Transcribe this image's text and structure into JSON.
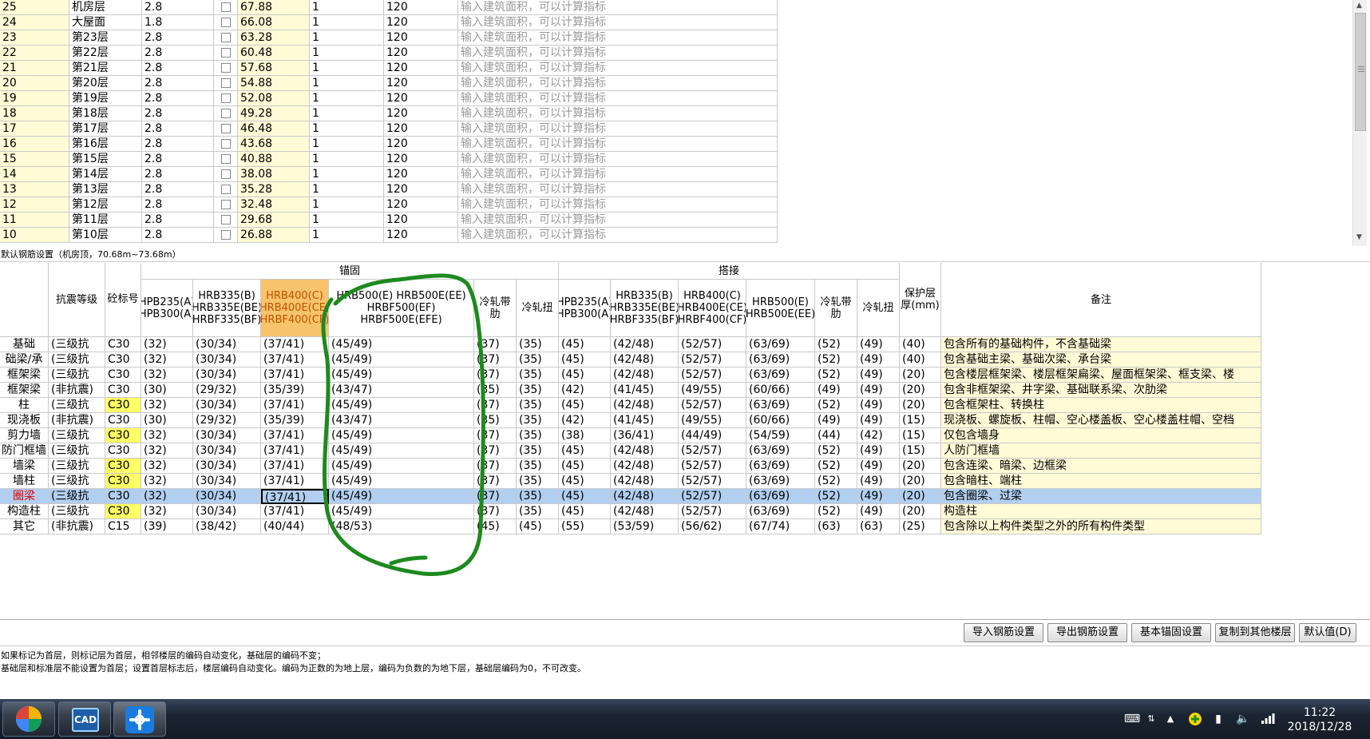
{
  "floors": [
    {
      "code": "25",
      "name": "机房层",
      "height": "2.8",
      "elevation": "67.88",
      "count": "1",
      "thickness": "120",
      "area_hint": "输入建筑面积，可以计算指标"
    },
    {
      "code": "24",
      "name": "大屋面",
      "height": "1.8",
      "elevation": "66.08",
      "count": "1",
      "thickness": "120",
      "area_hint": "输入建筑面积，可以计算指标"
    },
    {
      "code": "23",
      "name": "第23层",
      "height": "2.8",
      "elevation": "63.28",
      "count": "1",
      "thickness": "120",
      "area_hint": "输入建筑面积，可以计算指标"
    },
    {
      "code": "22",
      "name": "第22层",
      "height": "2.8",
      "elevation": "60.48",
      "count": "1",
      "thickness": "120",
      "area_hint": "输入建筑面积，可以计算指标"
    },
    {
      "code": "21",
      "name": "第21层",
      "height": "2.8",
      "elevation": "57.68",
      "count": "1",
      "thickness": "120",
      "area_hint": "输入建筑面积，可以计算指标"
    },
    {
      "code": "20",
      "name": "第20层",
      "height": "2.8",
      "elevation": "54.88",
      "count": "1",
      "thickness": "120",
      "area_hint": "输入建筑面积，可以计算指标"
    },
    {
      "code": "19",
      "name": "第19层",
      "height": "2.8",
      "elevation": "52.08",
      "count": "1",
      "thickness": "120",
      "area_hint": "输入建筑面积，可以计算指标"
    },
    {
      "code": "18",
      "name": "第18层",
      "height": "2.8",
      "elevation": "49.28",
      "count": "1",
      "thickness": "120",
      "area_hint": "输入建筑面积，可以计算指标"
    },
    {
      "code": "17",
      "name": "第17层",
      "height": "2.8",
      "elevation": "46.48",
      "count": "1",
      "thickness": "120",
      "area_hint": "输入建筑面积，可以计算指标"
    },
    {
      "code": "16",
      "name": "第16层",
      "height": "2.8",
      "elevation": "43.68",
      "count": "1",
      "thickness": "120",
      "area_hint": "输入建筑面积，可以计算指标"
    },
    {
      "code": "15",
      "name": "第15层",
      "height": "2.8",
      "elevation": "40.88",
      "count": "1",
      "thickness": "120",
      "area_hint": "输入建筑面积，可以计算指标"
    },
    {
      "code": "14",
      "name": "第14层",
      "height": "2.8",
      "elevation": "38.08",
      "count": "1",
      "thickness": "120",
      "area_hint": "输入建筑面积，可以计算指标"
    },
    {
      "code": "13",
      "name": "第13层",
      "height": "2.8",
      "elevation": "35.28",
      "count": "1",
      "thickness": "120",
      "area_hint": "输入建筑面积，可以计算指标"
    },
    {
      "code": "12",
      "name": "第12层",
      "height": "2.8",
      "elevation": "32.48",
      "count": "1",
      "thickness": "120",
      "area_hint": "输入建筑面积，可以计算指标"
    },
    {
      "code": "11",
      "name": "第11层",
      "height": "2.8",
      "elevation": "29.68",
      "count": "1",
      "thickness": "120",
      "area_hint": "输入建筑面积，可以计算指标"
    },
    {
      "code": "10",
      "name": "第10层",
      "height": "2.8",
      "elevation": "26.88",
      "count": "1",
      "thickness": "120",
      "area_hint": "输入建筑面积，可以计算指标"
    }
  ],
  "section_title": "默认钢筋设置（机房顶，70.68m~73.68m）",
  "headers": {
    "seismic": "抗震等级",
    "concrete": "砼标号",
    "anchor_group": "锚固",
    "lap_group": "搭接",
    "a_hpb": "HPB235(A) HPB300(A)",
    "a_hrb335": "HRB335(B) HRB335E(BE) HRBF335(BF)",
    "a_hrb400": "HRB400(C) HRB400E(CE) HRBF400(CF)",
    "a_hrb500": "HRB500(E) HRB500E(EE) HRBF500(EF) HRBF500E(EFE)",
    "a_cold_ribbed": "冷轧带肋",
    "a_cold_twisted": "冷轧扭",
    "l_hpb": "HPB235(A) HPB300(A)",
    "l_hrb335": "HRB335(B) HRB335E(BE) HRBF335(BF)",
    "l_hrb400": "HRB400(C) HRB400E(CE) HRBF400(CF)",
    "l_hrb500": "HRB500(E) HRB500E(EE)",
    "l_cold_ribbed": "冷轧带肋",
    "l_cold_twisted": "冷轧扭",
    "cover": "保护层厚(mm)",
    "note": "备注"
  },
  "rows": [
    {
      "type": "基础",
      "seismic": "(三级抗",
      "concrete": "C30",
      "a1": "(32)",
      "a2": "(30/34)",
      "a3": "(37/41)",
      "a4": "(45/49)",
      "a5": "(37)",
      "a6": "(35)",
      "l1": "(45)",
      "l2": "(42/48)",
      "l3": "(52/57)",
      "l4": "(63/69)",
      "l5": "(52)",
      "l6": "(49)",
      "cover": "(40)",
      "note": "包含所有的基础构件，不含基础梁"
    },
    {
      "type": "础梁/承",
      "seismic": "(三级抗",
      "concrete": "C30",
      "a1": "(32)",
      "a2": "(30/34)",
      "a3": "(37/41)",
      "a4": "(45/49)",
      "a5": "(37)",
      "a6": "(35)",
      "l1": "(45)",
      "l2": "(42/48)",
      "l3": "(52/57)",
      "l4": "(63/69)",
      "l5": "(52)",
      "l6": "(49)",
      "cover": "(40)",
      "note": "包含基础主梁、基础次梁、承台梁"
    },
    {
      "type": "框架梁",
      "seismic": "(三级抗",
      "concrete": "C30",
      "a1": "(32)",
      "a2": "(30/34)",
      "a3": "(37/41)",
      "a4": "(45/49)",
      "a5": "(37)",
      "a6": "(35)",
      "l1": "(45)",
      "l2": "(42/48)",
      "l3": "(52/57)",
      "l4": "(63/69)",
      "l5": "(52)",
      "l6": "(49)",
      "cover": "(20)",
      "note": "包含楼层框架梁、楼层框架扁梁、屋面框架梁、框支梁、楼"
    },
    {
      "type": "框架梁",
      "seismic": "(非抗震)",
      "concrete": "C30",
      "a1": "(30)",
      "a2": "(29/32)",
      "a3": "(35/39)",
      "a4": "(43/47)",
      "a5": "(35)",
      "a6": "(35)",
      "l1": "(42)",
      "l2": "(41/45)",
      "l3": "(49/55)",
      "l4": "(60/66)",
      "l5": "(49)",
      "l6": "(49)",
      "cover": "(20)",
      "note": "包含非框架梁、井字梁、基础联系梁、次肋梁"
    },
    {
      "type": "柱",
      "seismic": "(三级抗",
      "concrete": "C30",
      "a1": "(32)",
      "a2": "(30/34)",
      "a3": "(37/41)",
      "a4": "(45/49)",
      "a5": "(37)",
      "a6": "(35)",
      "l1": "(45)",
      "l2": "(42/48)",
      "l3": "(52/57)",
      "l4": "(63/69)",
      "l5": "(52)",
      "l6": "(49)",
      "cover": "(20)",
      "note": "包含框架柱、转换柱",
      "hl": true
    },
    {
      "type": "现浇板",
      "seismic": "(非抗震)",
      "concrete": "C30",
      "a1": "(30)",
      "a2": "(29/32)",
      "a3": "(35/39)",
      "a4": "(43/47)",
      "a5": "(35)",
      "a6": "(35)",
      "l1": "(42)",
      "l2": "(41/45)",
      "l3": "(49/55)",
      "l4": "(60/66)",
      "l5": "(49)",
      "l6": "(49)",
      "cover": "(15)",
      "note": "现浇板、螺旋板、柱帽、空心楼盖板、空心楼盖柱帽、空档"
    },
    {
      "type": "剪力墙",
      "seismic": "(三级抗",
      "concrete": "C30",
      "a1": "(32)",
      "a2": "(30/34)",
      "a3": "(37/41)",
      "a4": "(45/49)",
      "a5": "(37)",
      "a6": "(35)",
      "l1": "(38)",
      "l2": "(36/41)",
      "l3": "(44/49)",
      "l4": "(54/59)",
      "l5": "(44)",
      "l6": "(42)",
      "cover": "(15)",
      "note": "仅包含墙身",
      "hl": true
    },
    {
      "type": "防门框墙",
      "seismic": "(三级抗",
      "concrete": "C30",
      "a1": "(32)",
      "a2": "(30/34)",
      "a3": "(37/41)",
      "a4": "(45/49)",
      "a5": "(37)",
      "a6": "(35)",
      "l1": "(45)",
      "l2": "(42/48)",
      "l3": "(52/57)",
      "l4": "(63/69)",
      "l5": "(52)",
      "l6": "(49)",
      "cover": "(15)",
      "note": "人防门框墙"
    },
    {
      "type": "墙梁",
      "seismic": "(三级抗",
      "concrete": "C30",
      "a1": "(32)",
      "a2": "(30/34)",
      "a3": "(37/41)",
      "a4": "(45/49)",
      "a5": "(37)",
      "a6": "(35)",
      "l1": "(45)",
      "l2": "(42/48)",
      "l3": "(52/57)",
      "l4": "(63/69)",
      "l5": "(52)",
      "l6": "(49)",
      "cover": "(20)",
      "note": "包含连梁、暗梁、边框梁",
      "hl": true
    },
    {
      "type": "墙柱",
      "seismic": "(三级抗",
      "concrete": "C30",
      "a1": "(32)",
      "a2": "(30/34)",
      "a3": "(37/41)",
      "a4": "(45/49)",
      "a5": "(37)",
      "a6": "(35)",
      "l1": "(45)",
      "l2": "(42/48)",
      "l3": "(52/57)",
      "l4": "(63/69)",
      "l5": "(52)",
      "l6": "(49)",
      "cover": "(20)",
      "note": "包含暗柱、端柱",
      "hl": true
    },
    {
      "type": "圈梁",
      "seismic": "(三级抗",
      "concrete": "C30",
      "a1": "(32)",
      "a2": "(30/34)",
      "a3": "(37/41)",
      "a4": "(45/49)",
      "a5": "(37)",
      "a6": "(35)",
      "l1": "(45)",
      "l2": "(42/48)",
      "l3": "(52/57)",
      "l4": "(63/69)",
      "l5": "(52)",
      "l6": "(49)",
      "cover": "(20)",
      "note": "包含圈梁、过梁",
      "sel": true
    },
    {
      "type": "构造柱",
      "seismic": "(三级抗",
      "concrete": "C30",
      "a1": "(32)",
      "a2": "(30/34)",
      "a3": "(37/41)",
      "a4": "(45/49)",
      "a5": "(37)",
      "a6": "(35)",
      "l1": "(45)",
      "l2": "(42/48)",
      "l3": "(52/57)",
      "l4": "(63/69)",
      "l5": "(52)",
      "l6": "(49)",
      "cover": "(20)",
      "note": "构造柱",
      "hl": true
    },
    {
      "type": "其它",
      "seismic": "(非抗震)",
      "concrete": "C15",
      "a1": "(39)",
      "a2": "(38/42)",
      "a3": "(40/44)",
      "a4": "(48/53)",
      "a5": "(45)",
      "a6": "(45)",
      "l1": "(55)",
      "l2": "(53/59)",
      "l3": "(56/62)",
      "l4": "(67/74)",
      "l5": "(63)",
      "l6": "(63)",
      "cover": "(25)",
      "note": "包含除以上构件类型之外的所有构件类型"
    }
  ],
  "buttons": {
    "import": "导入钢筋设置",
    "export": "导出钢筋设置",
    "basic_anchor": "基本锚固设置",
    "copy_to_floors": "复制到其他楼层",
    "default": "默认值(D)"
  },
  "info": {
    "line1": "如果标记为首层，则标记层为首层，相邻楼层的编码自动变化，基础层的编码不变；",
    "line2": "基础层和标准层不能设置为首层；设置首层标志后，楼层编码自动变化。编码为正数的为地上层，编码为负数的为地下层，基础层编码为0，不可改变。"
  },
  "taskbar": {
    "cad_label": "CAD",
    "time": "11:22",
    "date": "2018/12/28"
  },
  "colors": {
    "yellow_cell": "#fffbd7",
    "highlight_yellow": "#ffff66",
    "selected_row": "#b2cff0",
    "orange_header": "#f7c46b",
    "annotation_green": "#1d8a1d"
  }
}
